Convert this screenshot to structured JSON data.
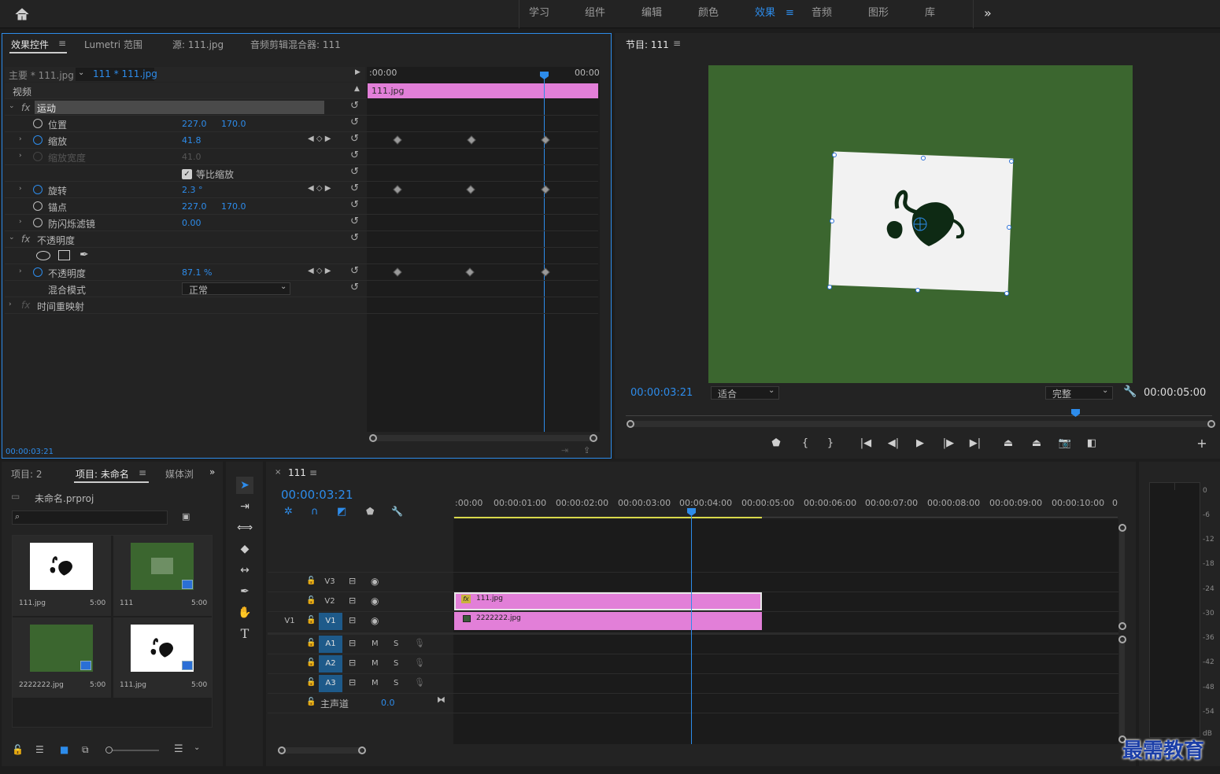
{
  "workspace": {
    "home": "home-icon",
    "items": [
      "学习",
      "组件",
      "编辑",
      "颜色",
      "效果",
      "音频",
      "图形",
      "库"
    ],
    "active": "效果",
    "more": "»",
    "active_color": "#2d8ceb"
  },
  "effect_controls": {
    "tabs": [
      "效果控件",
      "Lumetri 范围",
      "源: 111.jpg",
      "音频剪辑混合器: 111"
    ],
    "master": "主要 * 111.jpg",
    "clip": "111 * 111.jpg",
    "ruler_start": ":00:00",
    "ruler_end": "00:00",
    "clip_bar": "111.jpg",
    "section_video": "视频",
    "motion": "运动",
    "position": {
      "label": "位置",
      "x": "227.0",
      "y": "170.0"
    },
    "scale": {
      "label": "缩放",
      "value": "41.8"
    },
    "scale_width": {
      "label": "缩放宽度",
      "value": "41.0"
    },
    "uniform": {
      "label": "等比缩放",
      "checked": true
    },
    "rotation": {
      "label": "旋转",
      "value": "2.3 °"
    },
    "anchor": {
      "label": "锚点",
      "x": "227.0",
      "y": "170.0"
    },
    "antiflicker": {
      "label": "防闪烁滤镜",
      "value": "0.00"
    },
    "opacity_group": "不透明度",
    "opacity": {
      "label": "不透明度",
      "value": "87.1 %"
    },
    "blend": {
      "label": "混合模式",
      "value": "正常"
    },
    "time_remap": "时间重映射",
    "timecode": "00:00:03:21"
  },
  "program": {
    "title": "节目: 111",
    "timecode": "00:00:03:21",
    "fit": "适合",
    "quality": "完整",
    "duration": "00:00:05:00",
    "bg_color": "#3b662f"
  },
  "project": {
    "tabs": [
      "项目: 2",
      "项目: 未命名",
      "媒体浏"
    ],
    "file": "未命名.prproj",
    "items": [
      {
        "name": "111.jpg",
        "dur": "5:00"
      },
      {
        "name": "111",
        "dur": "5:00"
      },
      {
        "name": "2222222.jpg",
        "dur": "5:00"
      },
      {
        "name": "111.jpg",
        "dur": "5:00"
      }
    ]
  },
  "timeline": {
    "tab": "111",
    "timecode": "00:00:03:21",
    "ruler": [
      ":00:00",
      "00:00:01:00",
      "00:00:02:00",
      "00:00:03:00",
      "00:00:04:00",
      "00:00:05:00",
      "00:00:06:00",
      "00:00:07:00",
      "00:00:08:00",
      "00:00:09:00",
      "00:00:10:00",
      "0"
    ],
    "video_tracks": [
      "V3",
      "V2",
      "V1"
    ],
    "source_v": "V1",
    "audio_tracks": [
      "A1",
      "A2",
      "A3"
    ],
    "m": "M",
    "s": "S",
    "master": "主声道",
    "master_val": "0.0",
    "clip_v2": "111.jpg",
    "clip_v1": "2222222.jpg",
    "clip_color": "#e27fd8"
  },
  "meter": [
    "0",
    "-6",
    "-12",
    "-18",
    "-24",
    "-30",
    "-36",
    "-42",
    "-48",
    "-54",
    "dB"
  ],
  "watermark": "最需教育"
}
